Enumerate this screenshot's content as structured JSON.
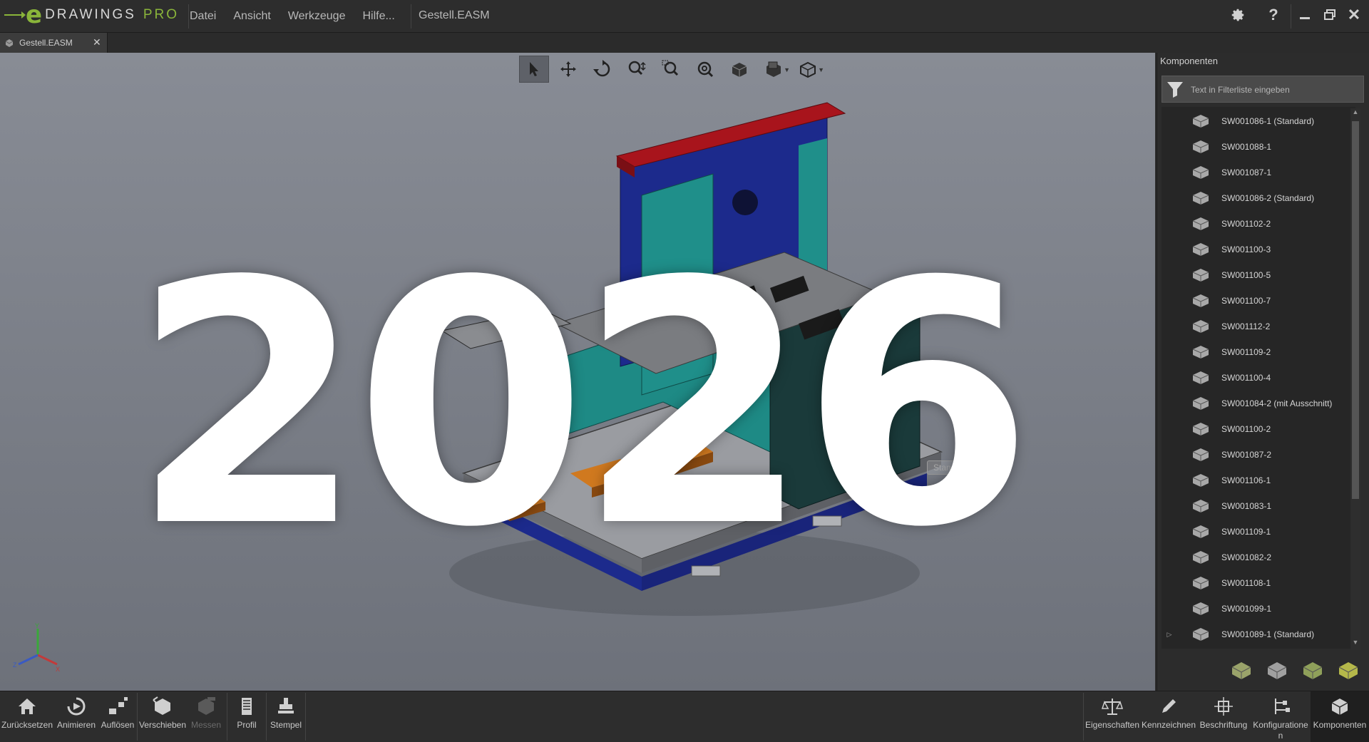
{
  "app": {
    "logo_name": "DRAWINGS",
    "logo_pro": "PRO",
    "logo_letter": "e",
    "menu": [
      "Datei",
      "Ansicht",
      "Werkzeuge",
      "Hilfe..."
    ],
    "document_title": "Gestell.EASM"
  },
  "tab": {
    "label": "Gestell.EASM",
    "close": "✕"
  },
  "overlay": {
    "text": "2026"
  },
  "viewport": {
    "tooltip_fragment": "Standard)",
    "view_tools": [
      "select-icon",
      "pan-icon",
      "rotate-icon",
      "zoom-icon",
      "zoom-to-area-icon",
      "zoom-to-fit-icon",
      "standard-views-icon",
      "section-icon",
      "display-style-icon"
    ]
  },
  "panel": {
    "title": "Komponenten",
    "filter_placeholder": "Text in Filterliste eingeben",
    "components": [
      "SW001086-1 (Standard)",
      "SW001088-1",
      "SW001087-1",
      "SW001086-2 (Standard)",
      "SW001102-2",
      "SW001100-3",
      "SW001100-5",
      "SW001100-7",
      "SW001112-2",
      "SW001109-2",
      "SW001100-4",
      "SW001084-2 (mit Ausschnitt)",
      "SW001100-2",
      "SW001087-2",
      "SW001106-1",
      "SW001083-1",
      "SW001109-1",
      "SW001082-2",
      "SW001108-1",
      "SW001099-1",
      "SW001089-1 (Standard)"
    ]
  },
  "bottom": {
    "left_tools": [
      "Zurücksetzen",
      "Animieren",
      "Auflösen",
      "Verschieben",
      "Messen",
      "Profil",
      "Stempel"
    ],
    "right_tools": [
      "Eigenschaften",
      "Kennzeichnen",
      "Beschriftung",
      "Konfiguratione\nn",
      "Komponenten"
    ]
  },
  "colors": {
    "accent_green": "#8ab53a",
    "viewport_top": "#888c95",
    "viewport_bottom": "#6d717a",
    "part_red": "#a8141c",
    "part_teal": "#1f8f8a",
    "part_blue": "#1c2a8c",
    "part_orange": "#c8711e",
    "part_gray": "#8a8c90"
  }
}
